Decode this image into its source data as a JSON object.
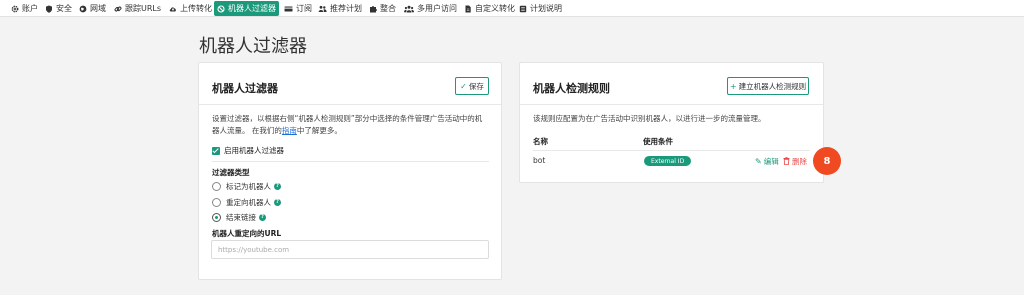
{
  "nav": {
    "items": [
      {
        "label": "账户",
        "icon": "gear-icon"
      },
      {
        "label": "安全",
        "icon": "shield-icon"
      },
      {
        "label": "网域",
        "icon": "globe-icon"
      },
      {
        "label": "跟踪URLs",
        "icon": "link-icon"
      },
      {
        "label": "上传转化",
        "icon": "cloud-upload-icon"
      },
      {
        "label": "机器人过滤器",
        "icon": "ban-icon",
        "active": true
      },
      {
        "label": "订阅",
        "icon": "card-icon"
      },
      {
        "label": "推荐计划",
        "icon": "users-icon"
      },
      {
        "label": "整合",
        "icon": "puzzle-icon"
      },
      {
        "label": "多用户访问",
        "icon": "group-icon"
      },
      {
        "label": "自定义转化",
        "icon": "file-icon"
      },
      {
        "label": "计划说明",
        "icon": "list-icon"
      }
    ]
  },
  "page": {
    "title": "机器人过滤器"
  },
  "filter_card": {
    "title": "机器人过滤器",
    "save_label": "保存",
    "desc_line1": "设置过滤器，以根据右侧“机器人检测规则”部分中选择的条件管理广告活动中的机",
    "desc_line2_prefix": "器人流量。 在我们的",
    "desc_link": "指南",
    "desc_line2_suffix": "中了解更多。",
    "enable_label": "启用机器人过滤器",
    "filter_type_label": "过滤器类型",
    "options": [
      {
        "label": "标记为机器人",
        "checked": false
      },
      {
        "label": "重定向机器人",
        "checked": false
      },
      {
        "label": "结束链接",
        "checked": true
      }
    ],
    "help_mark": "?",
    "url_label": "机器人重定向的URL",
    "url_placeholder": "https://youtube.com"
  },
  "rules_card": {
    "title": "机器人检测规则",
    "add_label": "建立机器人检测规则",
    "desc": "该规则应配置为在广告活动中识别机器人，以进行进一步的流量管理。",
    "col_name": "名称",
    "col_condition": "使用条件",
    "rows": [
      {
        "name": "bot",
        "condition": "External ID",
        "edit": "编辑",
        "delete": "删除"
      }
    ]
  },
  "step": {
    "number": "8"
  },
  "colors": {
    "accent": "#1a9a7b",
    "danger": "#e64a4a",
    "step": "#f04a23",
    "link": "#1e6fd9"
  }
}
